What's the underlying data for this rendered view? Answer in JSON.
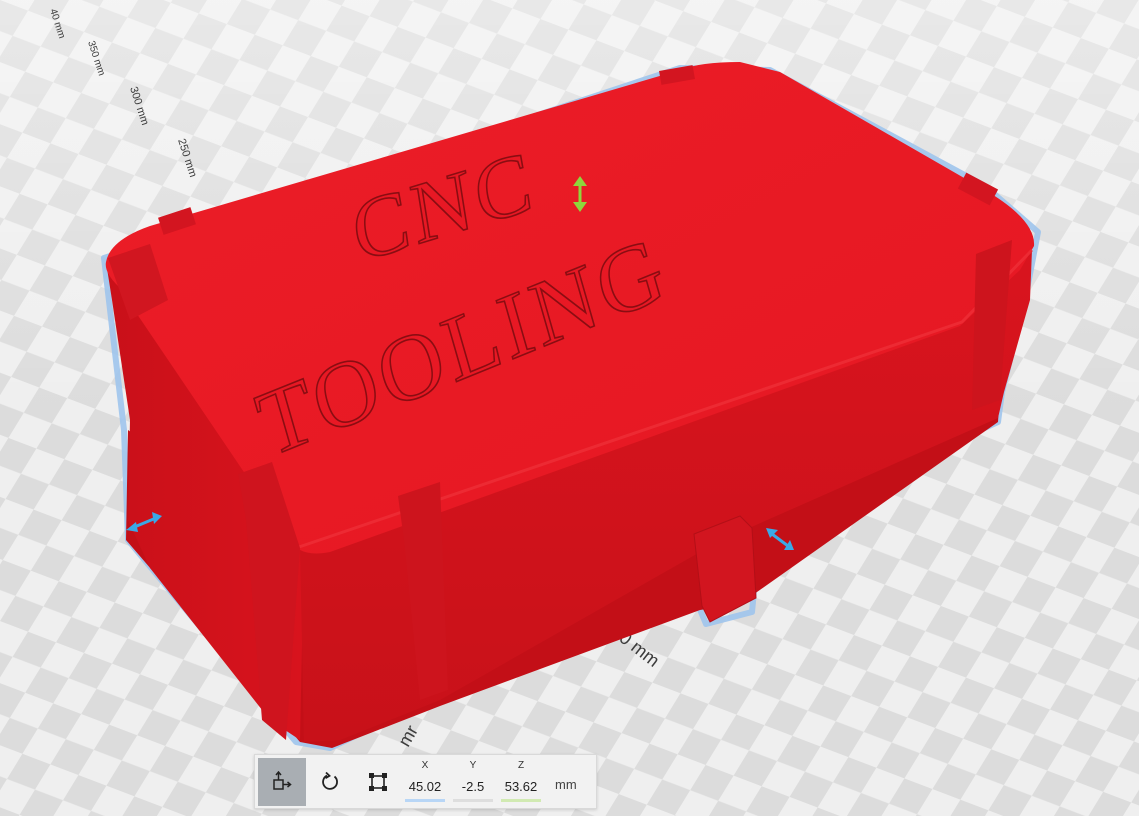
{
  "viewport": {
    "axis_labels": [
      "40 mm",
      "350 mm",
      "300 mm",
      "250 mm",
      "0 mm",
      "mr"
    ],
    "model_text": [
      "CNC",
      "TOOLING"
    ],
    "colors": {
      "model": "#e81824",
      "model_dark": "#c8121c",
      "model_edge": "#8a0d12",
      "outline": "#9fc4ec",
      "handle_vertical": "#8ed63c",
      "handle_horizontal": "#3aa8e6",
      "checker_light": "#efefef",
      "checker_dark": "#dcdcdc"
    }
  },
  "toolbar": {
    "tools": [
      {
        "name": "move",
        "icon": "move-icon",
        "active": true
      },
      {
        "name": "rotate",
        "icon": "rotate-icon",
        "active": false
      },
      {
        "name": "scale",
        "icon": "scale-icon",
        "active": false
      }
    ],
    "coords": [
      {
        "axis": "X",
        "value": "45.02",
        "color": "#4da3ff"
      },
      {
        "axis": "Y",
        "value": "-2.5",
        "color": "#c9c9c9"
      },
      {
        "axis": "Z",
        "value": "53.62",
        "color": "#a8e063"
      }
    ],
    "units": "mm"
  }
}
